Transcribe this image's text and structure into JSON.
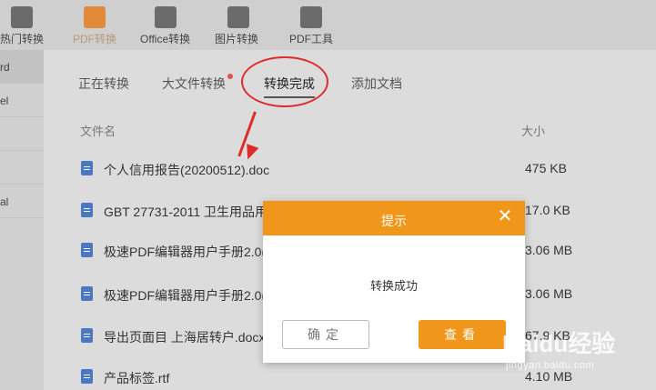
{
  "toolbar": {
    "items": [
      {
        "label": "热门转换",
        "icon": "home-icon"
      },
      {
        "label": "PDF转换",
        "icon": "pdf-icon"
      },
      {
        "label": "Office转换",
        "icon": "office-doc-icon"
      },
      {
        "label": "图片转换",
        "icon": "image-icon"
      },
      {
        "label": "PDF工具",
        "icon": "toolbox-icon"
      }
    ],
    "active_color": "#b89a78"
  },
  "sidebar": {
    "items": [
      {
        "label": "rd"
      },
      {
        "label": "el"
      },
      {
        "label": ""
      },
      {
        "label": ""
      },
      {
        "label": "al"
      }
    ]
  },
  "tabs": [
    {
      "label": "正在转换"
    },
    {
      "label": "大文件转换"
    },
    {
      "label": "转换完成"
    },
    {
      "label": "添加文档"
    }
  ],
  "table": {
    "col_name": "文件名",
    "col_size": "大小",
    "rows": [
      {
        "name": "个人信用报告(20200512).doc",
        "size": "475 KB"
      },
      {
        "name": "GBT 27731-2011 卫生用品用",
        "size": "17.0 KB"
      },
      {
        "name": "极速PDF编辑器用户手册2.0(",
        "size": "3.06 MB"
      },
      {
        "name": "极速PDF编辑器用户手册2.0(",
        "size": "3.06 MB"
      },
      {
        "name": "导出页面目 上海居转户.docx",
        "size": "67.9 KB"
      },
      {
        "name": "产品标签.rtf",
        "size": "4.10 MB"
      }
    ]
  },
  "dialog": {
    "title": "提示",
    "close_symbol": "✕",
    "message": "转换成功",
    "ok_label": "确定",
    "view_label": "查看",
    "accent": "#f0961a"
  },
  "watermark": {
    "main": "Baidu经验",
    "sub": "jingyan.baidu.com"
  }
}
